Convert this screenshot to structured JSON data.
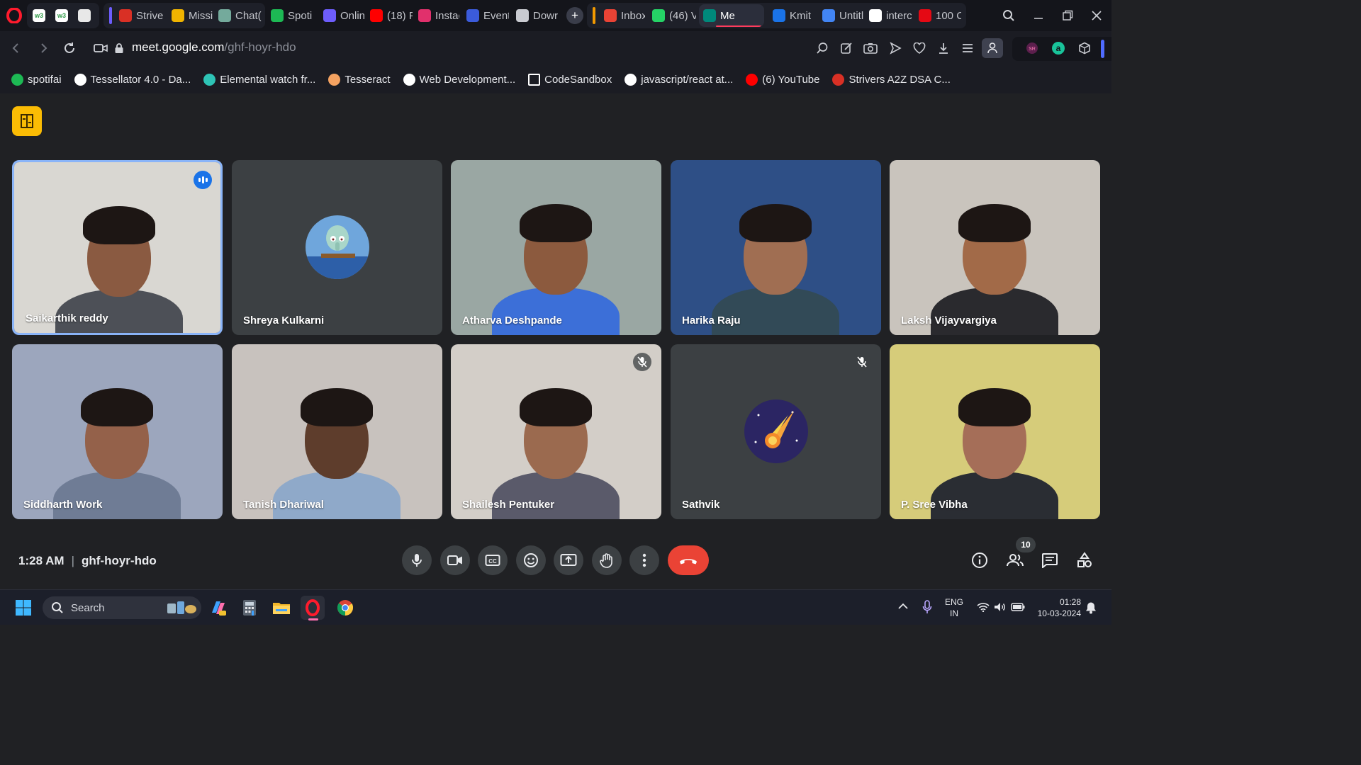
{
  "browser": {
    "tabs": [
      {
        "label": "",
        "icon": "w3schools-icon",
        "color": "#2f9a48"
      },
      {
        "label": "",
        "icon": "w3schools-icon",
        "color": "#2f9a48"
      },
      {
        "label": "",
        "icon": "notification-icon",
        "color": "#e8e8e8"
      },
      {
        "label": "Strive",
        "icon": "tuf-icon",
        "color": "#d93025"
      },
      {
        "label": "Missi",
        "icon": "bolt-icon",
        "color": "#f0b400"
      },
      {
        "label": "Chat(",
        "icon": "chatgpt-icon",
        "color": "#74aa9c"
      },
      {
        "label": "Spoti",
        "icon": "spotify-icon",
        "color": "#1db954"
      },
      {
        "label": "Onlin",
        "icon": "code-icon",
        "color": "#6d5dfc"
      },
      {
        "label": "(18) F",
        "icon": "youtube-icon",
        "color": "#ff0000"
      },
      {
        "label": "Instac",
        "icon": "instagram-icon",
        "color": "#e1306c"
      },
      {
        "label": "Event",
        "icon": "event-icon",
        "color": "#3b5bdb"
      },
      {
        "label": "Dowr",
        "icon": "download-icon",
        "color": "#c9cbd1"
      },
      {
        "label": "Inbox",
        "icon": "gmail-icon",
        "color": "#ea4335"
      },
      {
        "label": "(46) V",
        "icon": "whatsapp-icon",
        "color": "#25d366"
      },
      {
        "label": "Me",
        "icon": "meet-icon",
        "color": "#00897b"
      },
      {
        "label": "Kmit",
        "icon": "drive-icon",
        "color": "#1a73e8"
      },
      {
        "label": "Untitl",
        "icon": "docs-icon",
        "color": "#4285f4"
      },
      {
        "label": "interc",
        "icon": "google-icon",
        "color": "#ffffff"
      },
      {
        "label": "100 C",
        "icon": "netflix-icon",
        "color": "#e50914"
      }
    ],
    "url_prefix": "meet.google.com",
    "url_path": "/ghf-hoyr-hdo",
    "bookmarks": [
      {
        "label": "spotifai",
        "icon": "spotify-icon",
        "color": "#1db954"
      },
      {
        "label": "Tessellator 4.0 - Da...",
        "icon": "tessellator-icon",
        "color": "#ffffff"
      },
      {
        "label": "Elemental watch fr...",
        "icon": "elemental-icon",
        "color": "#2ec4b6"
      },
      {
        "label": "Tesseract",
        "icon": "tesseract-icon",
        "color": "#f4a261"
      },
      {
        "label": "Web Development...",
        "icon": "webdev-icon",
        "color": "#ffffff"
      },
      {
        "label": "CodeSandbox",
        "icon": "codesandbox-icon",
        "color": "#ffffff"
      },
      {
        "label": "javascript/react at...",
        "icon": "github-icon",
        "color": "#ffffff"
      },
      {
        "label": "(6) YouTube",
        "icon": "youtube-icon",
        "color": "#ff0000"
      },
      {
        "label": "Strivers A2Z DSA C...",
        "icon": "tuf-icon",
        "color": "#d93025"
      }
    ]
  },
  "meet": {
    "participants": [
      {
        "name": "Saikarthik reddy",
        "speaking": true,
        "muted": false,
        "video": true,
        "bg": "#d9d7d2",
        "shirt": "#4d5057",
        "skin": "#8a5a41"
      },
      {
        "name": "Shreya Kulkarni",
        "speaking": false,
        "muted": false,
        "video": false,
        "avatar": "squidward-avatar"
      },
      {
        "name": "Atharva Deshpande",
        "speaking": false,
        "muted": false,
        "video": true,
        "bg": "#9aa7a3",
        "shirt": "#3c6fd8",
        "skin": "#8c5a3e"
      },
      {
        "name": "Harika Raju",
        "speaking": false,
        "muted": false,
        "video": true,
        "bg": "#2e4f86",
        "shirt": "#324a57",
        "skin": "#a06e52"
      },
      {
        "name": "Laksh Vijayvargiya",
        "speaking": false,
        "muted": false,
        "video": true,
        "bg": "#c9c4bd",
        "shirt": "#2a2a2e",
        "skin": "#a26a48"
      },
      {
        "name": "Siddharth Work",
        "speaking": false,
        "muted": false,
        "video": true,
        "bg": "#9ca6bd",
        "shirt": "#6f7c95",
        "skin": "#94614a"
      },
      {
        "name": "Tanish Dhariwal",
        "speaking": false,
        "muted": false,
        "video": true,
        "bg": "#c8c2be",
        "shirt": "#8fa9c9",
        "skin": "#5e3d2c"
      },
      {
        "name": "Shailesh Pentuker",
        "speaking": false,
        "muted": true,
        "video": true,
        "bg": "#d3cec8",
        "shirt": "#5a5a6a",
        "skin": "#9b6a4f"
      },
      {
        "name": "Sathvik",
        "speaking": false,
        "muted": true,
        "video": false,
        "avatar": "comet-avatar"
      },
      {
        "name": "P. Sree Vibha",
        "speaking": false,
        "muted": false,
        "video": true,
        "bg": "#d6cc7a",
        "shirt": "#2a2d33",
        "skin": "#a56e58"
      }
    ],
    "time": "1:28 AM",
    "meeting_code": "ghf-hoyr-hdo",
    "people_count": "10",
    "colors": {
      "accent": "#8ab4f8",
      "hangup": "#ea4335",
      "panel": "#fbbc04",
      "bg": "#202124"
    }
  },
  "taskbar": {
    "search_label": "Search",
    "lang_top": "ENG",
    "lang_bottom": "IN",
    "clock_time": "01:28",
    "clock_date": "10-03-2024"
  }
}
